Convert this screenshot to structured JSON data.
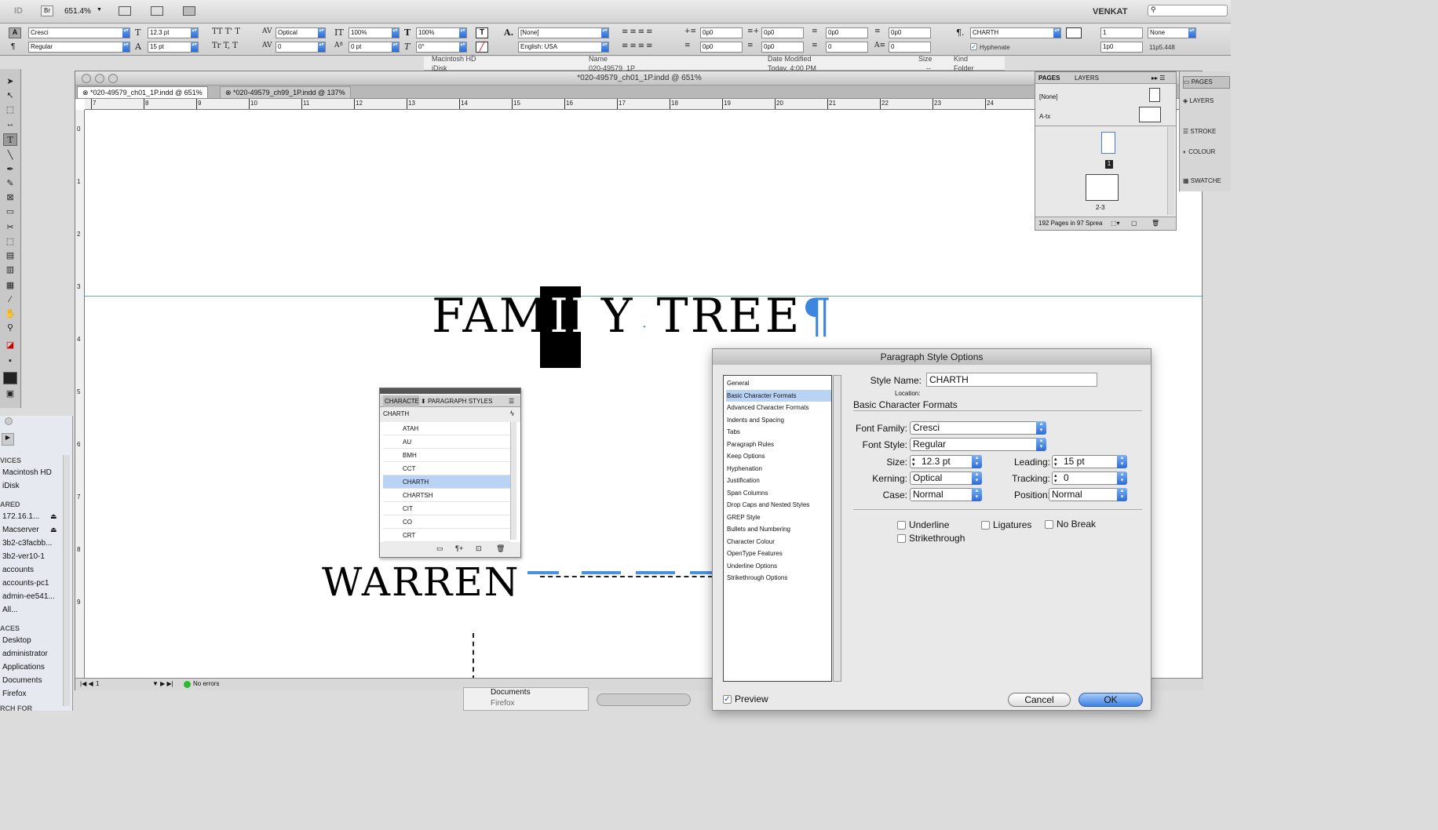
{
  "app": {
    "logo": "ID",
    "br": "Br",
    "zoom": "651.4%",
    "user": "VENKAT"
  },
  "control": {
    "font_family": "Cresci",
    "font_style": "Regular",
    "size": "12.3 pt",
    "leading": "15 pt",
    "kerning": "Optical",
    "tracking": "0",
    "vscale": "100%",
    "hscale": "100%",
    "baseline": "0 pt",
    "skew": "0°",
    "char_style": "[None]",
    "language": "English: USA",
    "left_indent": "0p0",
    "first_indent": "0p0",
    "right_indent": "0p0",
    "last_indent": "0p0",
    "space_before": "0p0",
    "space_after": "0p0",
    "drop_lines": "0",
    "drop_chars": "0",
    "para_style": "CHARTH",
    "hyphenate": "Hyphenate",
    "cols": "1",
    "col_gap": "1p0",
    "span": "None",
    "width": "11p5.448"
  },
  "behind": {
    "col_name": "Name",
    "col_modified": "Date Modified",
    "col_size": "Size",
    "col_kind": "Kind",
    "row1": "Macintosh HD",
    "row2": "iDisk",
    "folder": "020-49579_1P",
    "date": "Today, 4:00 PM",
    "dashes": "--",
    "kind": "Folder",
    "docs": "Documents",
    "firefox": "Firefox"
  },
  "doc": {
    "title": "*020-49579_ch01_1P.indd @ 651%",
    "tab1": "*020-49579_ch01_1P.indd @ 651%",
    "tab2": "*020-49579_ch99_1P.indd @ 137%",
    "page": "1",
    "errors": "No errors"
  },
  "hruler": [
    "7",
    "8",
    "9",
    "10",
    "11",
    "12",
    "13",
    "14",
    "15",
    "16",
    "17",
    "18",
    "19",
    "20",
    "21",
    "22",
    "23",
    "24"
  ],
  "vruler": [
    "0",
    "1",
    "2",
    "3",
    "4",
    "5",
    "6",
    "7",
    "8",
    "9"
  ],
  "canvas": {
    "t1a": "FAM",
    "t1hi": "IL",
    "t1b": "Y",
    "t1c": "TREE",
    "pilcrow": "¶",
    "name": "WARREN"
  },
  "finder": {
    "devices": "VICES",
    "mac": "Macintosh HD",
    "idisk": "iDisk",
    "shared": "ARED",
    "ip": "172.16.1...",
    "macserver": "Macserver",
    "s1": "3b2-c3facbb...",
    "s2": "3b2-ver10-1",
    "s3": "accounts",
    "s4": "accounts-pc1",
    "s5": "admin-ee541...",
    "s6": "All...",
    "places": "ACES",
    "p1": "Desktop",
    "p2": "administrator",
    "p3": "Applications",
    "p4": "Documents",
    "p5": "Firefox",
    "more": "RCH FOR"
  },
  "pages": {
    "tab_pages": "PAGES",
    "tab_layers": "LAYERS",
    "none": "[None]",
    "atx": "A-tx",
    "p1": "1",
    "spread": "2-3",
    "footer": "192 Pages in 97 Sprea"
  },
  "side": {
    "pages": "PAGES",
    "layers": "LAYERS",
    "stroke": "STROKE",
    "colour": "COLOUR",
    "swatches": "SWATCHE"
  },
  "ps_panel": {
    "tab1": "CHARACTE",
    "tab2": "PARAGRAPH STYLES",
    "current": "CHARTH",
    "items": [
      "ATAH",
      "AU",
      "BMH",
      "CCT",
      "CHARTH",
      "CHARTSH",
      "CIT",
      "CO",
      "CRT"
    ]
  },
  "dialog": {
    "title": "Paragraph Style Options",
    "categories": [
      "General",
      "Basic Character Formats",
      "Advanced Character Formats",
      "Indents and Spacing",
      "Tabs",
      "Paragraph Rules",
      "Keep Options",
      "Hyphenation",
      "Justification",
      "Span Columns",
      "Drop Caps and Nested Styles",
      "GREP Style",
      "Bullets and Numbering",
      "Character Colour",
      "OpenType Features",
      "Underline Options",
      "Strikethrough Options"
    ],
    "style_name_label": "Style Name:",
    "style_name": "CHARTH",
    "location_label": "Location:",
    "section": "Basic Character Formats",
    "font_family_label": "Font Family:",
    "font_family": "Cresci",
    "font_style_label": "Font Style:",
    "font_style": "Regular",
    "size_label": "Size:",
    "size": "12.3 pt",
    "leading_label": "Leading:",
    "leading": "15 pt",
    "kerning_label": "Kerning:",
    "kerning": "Optical",
    "tracking_label": "Tracking:",
    "tracking": "0",
    "case_label": "Case:",
    "case": "Normal",
    "position_label": "Position:",
    "position": "Normal",
    "underline": "Underline",
    "ligatures": "Ligatures",
    "no_break": "No Break",
    "strikethrough": "Strikethrough",
    "preview": "Preview",
    "cancel": "Cancel",
    "ok": "OK"
  }
}
